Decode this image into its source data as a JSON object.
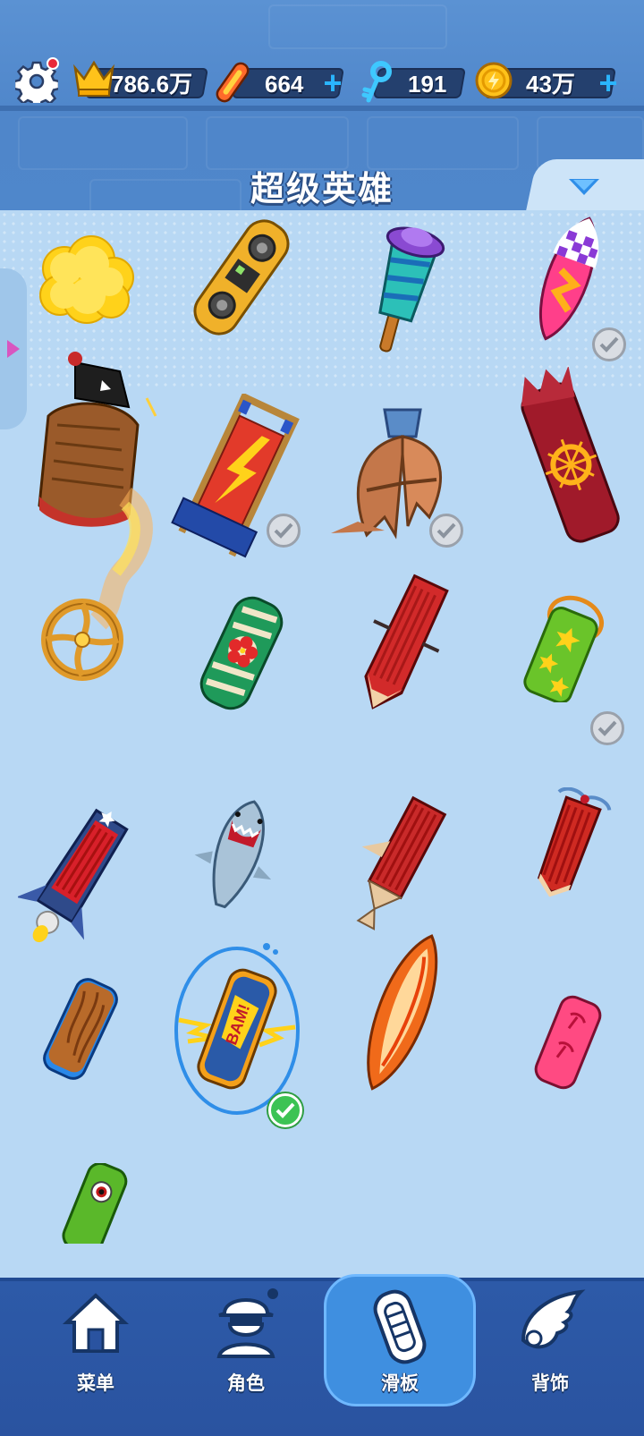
{
  "header": {
    "crowns": "786.6万",
    "boards": "664",
    "keys": "191",
    "coins": "43万",
    "plus": "+"
  },
  "page_title": "超级英雄",
  "items": [
    {
      "id": "cloud",
      "checked": false
    },
    {
      "id": "boombox-board",
      "checked": false
    },
    {
      "id": "popsicle-rocket",
      "checked": false
    },
    {
      "id": "checkered-surfboard",
      "checked": true
    },
    {
      "id": "pirate-ship",
      "checked": false
    },
    {
      "id": "lightning-sled",
      "checked": true
    },
    {
      "id": "bat-wing-glider",
      "checked": true
    },
    {
      "id": "dragon-board",
      "checked": false
    },
    {
      "id": "golden-wheel",
      "checked": false
    },
    {
      "id": "hibiscus-board",
      "checked": false
    },
    {
      "id": "red-flying-board",
      "checked": false
    },
    {
      "id": "star-board",
      "checked": true
    },
    {
      "id": "rocket-board",
      "checked": false
    },
    {
      "id": "shark-board",
      "checked": false
    },
    {
      "id": "red-glider-board",
      "checked": false
    },
    {
      "id": "hovercraft-board",
      "checked": false
    },
    {
      "id": "wooden-board",
      "checked": false
    },
    {
      "id": "bam-board",
      "checked": true,
      "selected": true
    },
    {
      "id": "flame-surfboard",
      "checked": false
    },
    {
      "id": "pink-palm-board",
      "checked": false
    },
    {
      "id": "eyeball-board",
      "checked": false
    }
  ],
  "nav": {
    "menu": "菜单",
    "character": "角色",
    "board": "滑板",
    "backpack": "背饰"
  }
}
